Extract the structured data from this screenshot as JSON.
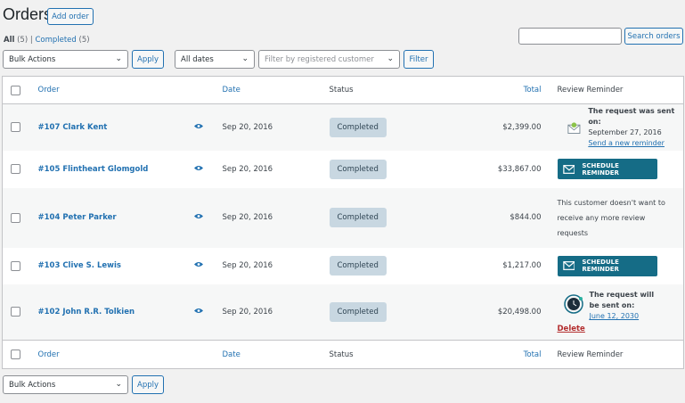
{
  "header": {
    "title": "Orders",
    "add_order": "Add order"
  },
  "views": {
    "all": "All",
    "all_count": "(5)",
    "sep": "|",
    "completed": "Completed",
    "completed_count": "(5)"
  },
  "search": {
    "value": "",
    "button": "Search orders"
  },
  "filters": {
    "bulk_actions": "Bulk Actions",
    "apply": "Apply",
    "dates": "All dates",
    "customer_placeholder": "Filter by registered customer",
    "filter": "Filter"
  },
  "columns": {
    "order": "Order",
    "date": "Date",
    "status": "Status",
    "total": "Total",
    "review": "Review Reminder"
  },
  "rows": [
    {
      "order": "#107 Clark Kent",
      "date": "Sep 20, 2016",
      "status": "Completed",
      "total": "$2,399.00",
      "review": {
        "type": "sent",
        "line1": "The request was sent on:",
        "line2": "September 27, 2016",
        "link": "Send a new reminder"
      }
    },
    {
      "order": "#105 Flintheart Glomgold",
      "date": "Sep 20, 2016",
      "status": "Completed",
      "total": "$33,867.00",
      "review": {
        "type": "button",
        "label": "SCHEDULE REMINDER"
      }
    },
    {
      "order": "#104 Peter Parker",
      "date": "Sep 20, 2016",
      "status": "Completed",
      "total": "$844.00",
      "review": {
        "type": "text",
        "text": "This customer doesn't want to receive any more review requests"
      }
    },
    {
      "order": "#103 Clive S. Lewis",
      "date": "Sep 20, 2016",
      "status": "Completed",
      "total": "$1,217.00",
      "review": {
        "type": "button",
        "label": "SCHEDULE REMINDER"
      }
    },
    {
      "order": "#102 John R.R. Tolkien",
      "date": "Sep 20, 2016",
      "status": "Completed",
      "total": "$20,498.00",
      "review": {
        "type": "scheduled",
        "line1": "The request will be sent on:",
        "link": "June 12, 2030",
        "delete": "Delete"
      }
    }
  ],
  "colors": {
    "accent": "#2271b1",
    "schedule_button": "#156c86",
    "delete": "#b32d2e",
    "badge": "#c8d7e1"
  }
}
